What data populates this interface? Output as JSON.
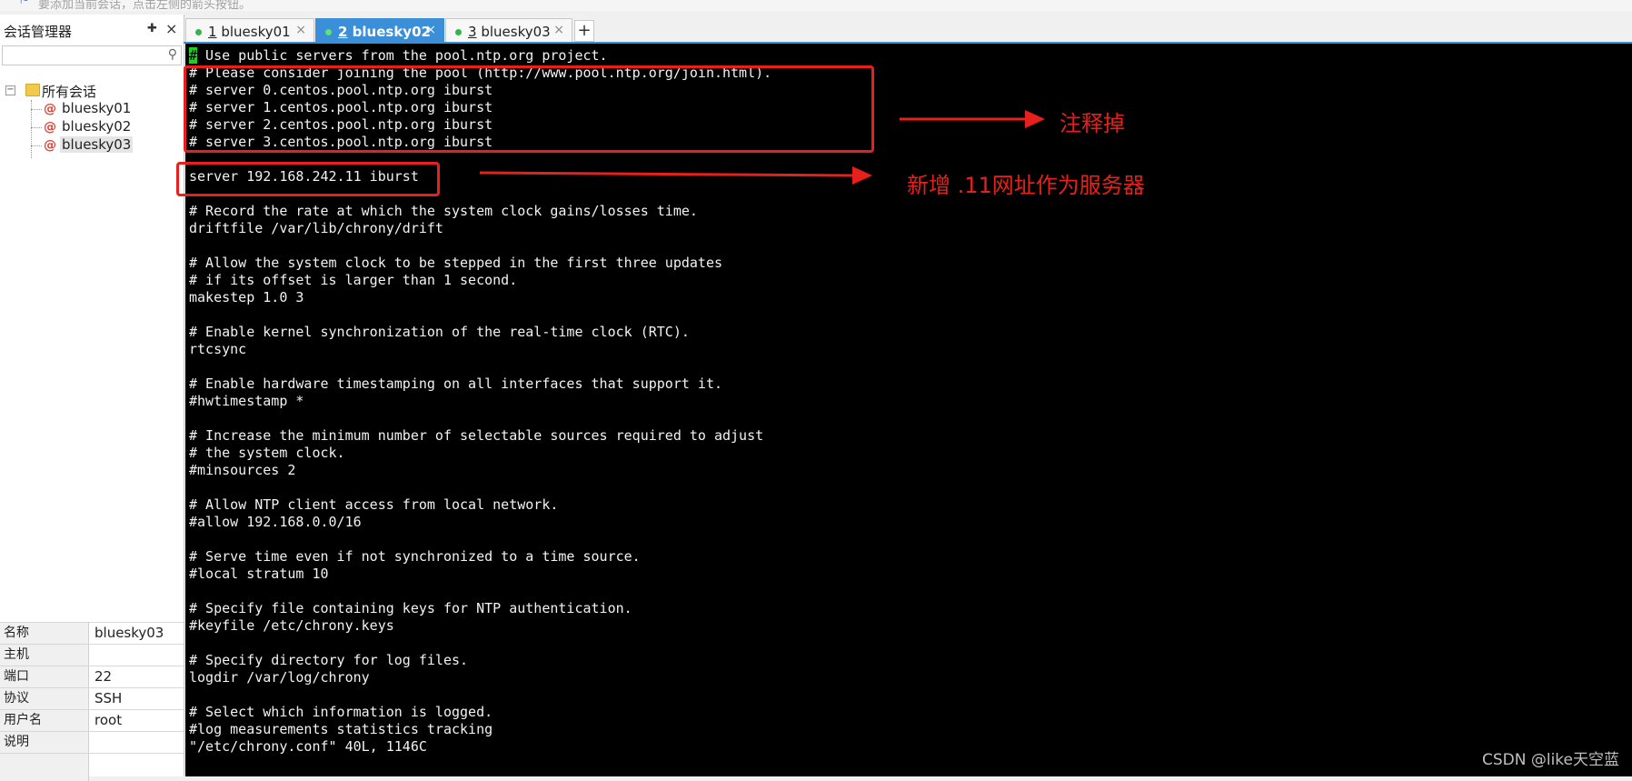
{
  "hint": "要添加当前会话，点击左侧的箭头按钮。",
  "session_panel": {
    "title": "会话管理器",
    "search": {
      "value": "",
      "placeholder": ""
    },
    "root_label": "所有会话",
    "sessions": [
      "bluesky01",
      "bluesky02",
      "bluesky03"
    ],
    "selected": "bluesky03",
    "properties": [
      {
        "key": "名称",
        "value": "bluesky03"
      },
      {
        "key": "主机",
        "value": ""
      },
      {
        "key": "端口",
        "value": "22"
      },
      {
        "key": "协议",
        "value": "SSH"
      },
      {
        "key": "用户名",
        "value": "root"
      },
      {
        "key": "说明",
        "value": ""
      }
    ]
  },
  "tabs": [
    {
      "number": "1",
      "name": "bluesky01",
      "active": false
    },
    {
      "number": "2",
      "name": "bluesky02",
      "active": true
    },
    {
      "number": "3",
      "name": "bluesky03",
      "active": false
    }
  ],
  "terminal": {
    "lines": [
      "# Use public servers from the pool.ntp.org project.",
      "# Please consider joining the pool (http://www.pool.ntp.org/join.html).",
      "# server 0.centos.pool.ntp.org iburst",
      "# server 1.centos.pool.ntp.org iburst",
      "# server 2.centos.pool.ntp.org iburst",
      "# server 3.centos.pool.ntp.org iburst",
      "",
      "server 192.168.242.11 iburst",
      "",
      "# Record the rate at which the system clock gains/losses time.",
      "driftfile /var/lib/chrony/drift",
      "",
      "# Allow the system clock to be stepped in the first three updates",
      "# if its offset is larger than 1 second.",
      "makestep 1.0 3",
      "",
      "# Enable kernel synchronization of the real-time clock (RTC).",
      "rtcsync",
      "",
      "# Enable hardware timestamping on all interfaces that support it.",
      "#hwtimestamp *",
      "",
      "# Increase the minimum number of selectable sources required to adjust",
      "# the system clock.",
      "#minsources 2",
      "",
      "# Allow NTP client access from local network.",
      "#allow 192.168.0.0/16",
      "",
      "# Serve time even if not synchronized to a time source.",
      "#local stratum 10",
      "",
      "# Specify file containing keys for NTP authentication.",
      "#keyfile /etc/chrony.keys",
      "",
      "# Specify directory for log files.",
      "logdir /var/log/chrony",
      "",
      "# Select which information is logged.",
      "#log measurements statistics tracking",
      "\"/etc/chrony.conf\" 40L, 1146C"
    ]
  },
  "annotations": {
    "comment_out": "注释掉",
    "new_server": "新增 .11网址作为服务器"
  },
  "watermark": "CSDN @like天空蓝",
  "colors": {
    "accent": "#3b8ed8",
    "annotation": "#e8201c",
    "terminal_bg": "#000000"
  }
}
